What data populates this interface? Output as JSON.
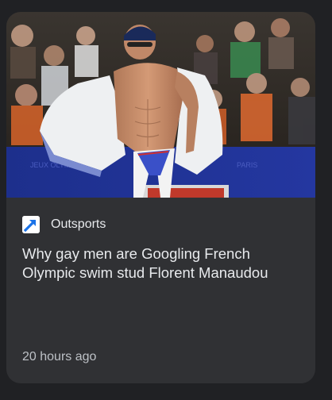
{
  "article": {
    "image_alt": "Swimmer removing a white jacket on the pool deck",
    "source": {
      "name": "Outsports",
      "logo_icon": "arrow-up-right-icon",
      "logo_color": "#1a73e8"
    },
    "headline": "Why gay men are Googling French Olympic swim stud Florent Manaudou",
    "timestamp": "20 hours ago"
  },
  "colors": {
    "page_background": "#202124",
    "card_background": "#303134",
    "text_primary": "#e8eaed",
    "text_secondary": "#bdc1c6"
  }
}
